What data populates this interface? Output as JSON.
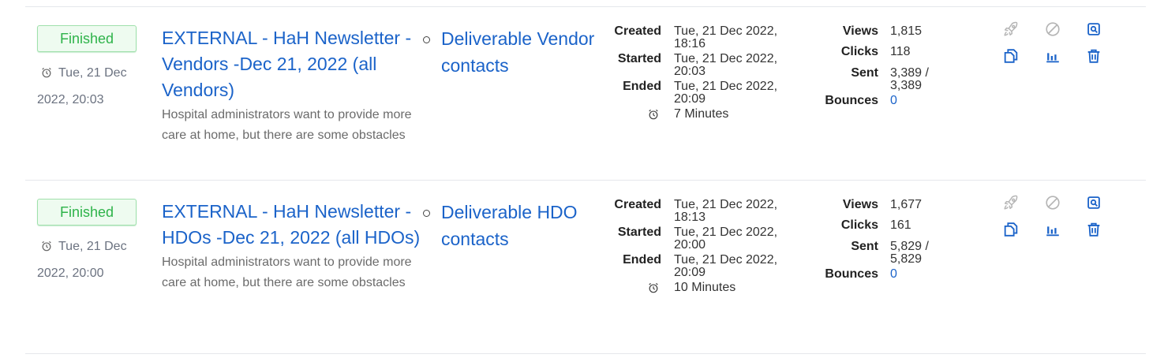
{
  "campaigns": [
    {
      "status": "Finished",
      "status_date_line1": "Tue, 21 Dec",
      "status_date_line2": "2022, 20:03",
      "title": "EXTERNAL - HaH Newsletter - Vendors -Dec 21, 2022 (all Vendors)",
      "subject": "Hospital administrators want to provide more care at home, but there are some obstacles",
      "list": "Deliverable Vendor contacts",
      "created_label": "Created",
      "created": "Tue, 21 Dec 2022, 18:16",
      "started_label": "Started",
      "started": "Tue, 21 Dec 2022, 20:03",
      "ended_label": "Ended",
      "ended": "Tue, 21 Dec 2022, 20:09",
      "duration": "7 Minutes",
      "views_label": "Views",
      "views": "1,815",
      "clicks_label": "Clicks",
      "clicks": "118",
      "sent_label": "Sent",
      "sent": "3,389 / 3,389",
      "bounces_label": "Bounces",
      "bounces": "0"
    },
    {
      "status": "Finished",
      "status_date_line1": "Tue, 21 Dec",
      "status_date_line2": "2022, 20:00",
      "title": "EXTERNAL - HaH Newsletter - HDOs -Dec 21, 2022 (all HDOs)",
      "subject": "Hospital administrators want to provide more care at home, but there are some obstacles",
      "list": "Deliverable HDO contacts",
      "created_label": "Created",
      "created": "Tue, 21 Dec 2022, 18:13",
      "started_label": "Started",
      "started": "Tue, 21 Dec 2022, 20:00",
      "ended_label": "Ended",
      "ended": "Tue, 21 Dec 2022, 20:09",
      "duration": "10 Minutes",
      "views_label": "Views",
      "views": "1,677",
      "clicks_label": "Clicks",
      "clicks": "161",
      "sent_label": "Sent",
      "sent": "5,829 / 5,829",
      "bounces_label": "Bounces",
      "bounces": "0"
    }
  ],
  "colors": {
    "link": "#1b63c9",
    "status_green": "#2eb34a",
    "disabled_icon": "#b5b5b5"
  },
  "icons": {
    "status_date": "alarm-clock-icon",
    "duration": "alarm-clock-icon",
    "actions": [
      "rocket-icon",
      "cancel-icon",
      "preview-icon",
      "clone-icon",
      "analytics-icon",
      "delete-icon"
    ]
  }
}
